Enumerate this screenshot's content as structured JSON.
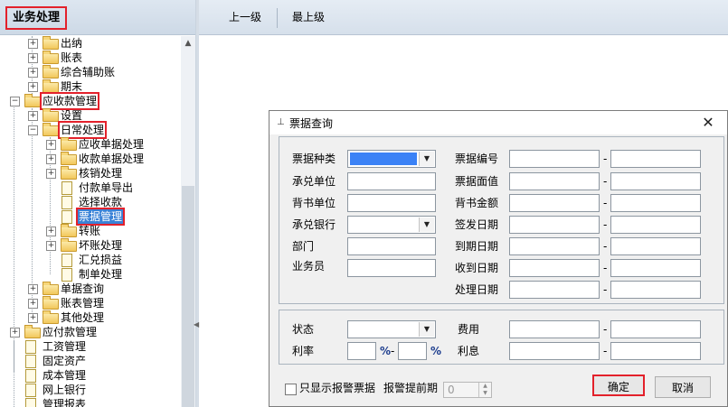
{
  "left_panel": {
    "title": "业务处理",
    "tree": [
      {
        "label": "出纳"
      },
      {
        "label": "账表"
      },
      {
        "label": "综合辅助账"
      },
      {
        "label": "期末"
      },
      {
        "label": "应收款管理"
      },
      {
        "label": "设置"
      },
      {
        "label": "日常处理"
      },
      {
        "label": "应收单据处理"
      },
      {
        "label": "收款单据处理"
      },
      {
        "label": "核销处理"
      },
      {
        "label": "付款单导出"
      },
      {
        "label": "选择收款"
      },
      {
        "label": "票据管理"
      },
      {
        "label": "转账"
      },
      {
        "label": "坏账处理"
      },
      {
        "label": "汇兑损益"
      },
      {
        "label": "制单处理"
      },
      {
        "label": "单据查询"
      },
      {
        "label": "账表管理"
      },
      {
        "label": "其他处理"
      },
      {
        "label": "应付款管理"
      },
      {
        "label": "工资管理"
      },
      {
        "label": "固定资产"
      },
      {
        "label": "成本管理"
      },
      {
        "label": "网上银行"
      },
      {
        "label": "管理报表"
      }
    ]
  },
  "toolbar": {
    "up_label": "上一级",
    "top_label": "最上级"
  },
  "dialog": {
    "title": "票据查询",
    "close_glyph": "✕",
    "labels": {
      "bill_type": "票据种类",
      "acceptor_unit": "承兑单位",
      "endorse_unit": "背书单位",
      "acceptor_bank": "承兑银行",
      "department": "部门",
      "salesperson": "业务员",
      "bill_no": "票据编号",
      "bill_amount": "票据面值",
      "endorse_amount": "背书金额",
      "issue_date": "签发日期",
      "due_date": "到期日期",
      "received_date": "收到日期",
      "process_date": "处理日期",
      "status": "状态",
      "fee": "费用",
      "rate": "利率",
      "interest": "利息",
      "percent": "%",
      "dash": "-",
      "alert_only": "只显示报警票据",
      "alert_lead": "报警提前期"
    },
    "alert_lead_value": "0",
    "ok_label": "确定",
    "cancel_label": "取消"
  },
  "colors": {
    "highlight_red": "#e3212b",
    "selection_blue": "#3b82f6"
  }
}
